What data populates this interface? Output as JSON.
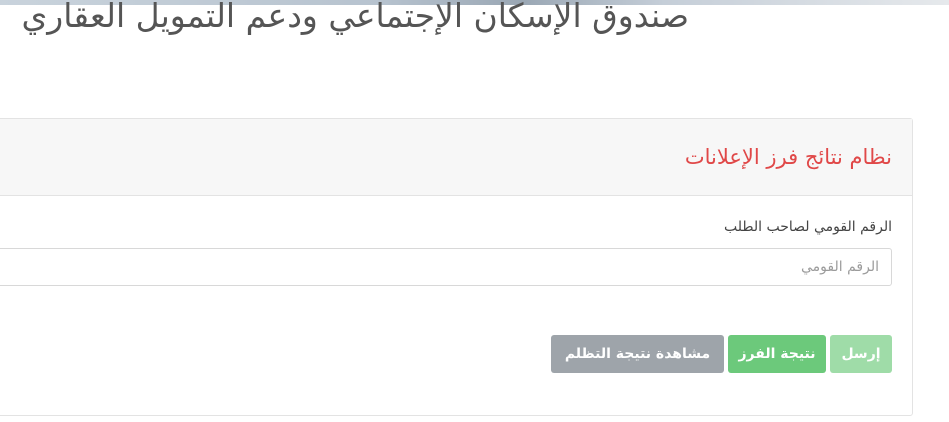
{
  "header": {
    "title": "صندوق الإسكان الإجتماعي ودعم التمويل العقاري"
  },
  "panel": {
    "title": "نظام نتائج فرز الإعلانات",
    "national_id": {
      "label": "الرقم القومي لصاحب الطلب",
      "placeholder": "الرقم القومي",
      "value": ""
    },
    "buttons": {
      "submit": "إرسل",
      "sort_result": "نتيجة الفرز",
      "appeal_result": "مشاهدة نتيجة التظلم"
    }
  },
  "colors": {
    "title_red": "#e04848",
    "submit_green_light": "#9fdca8",
    "sort_green": "#6cc97b",
    "appeal_gray": "#9ea4aa"
  }
}
